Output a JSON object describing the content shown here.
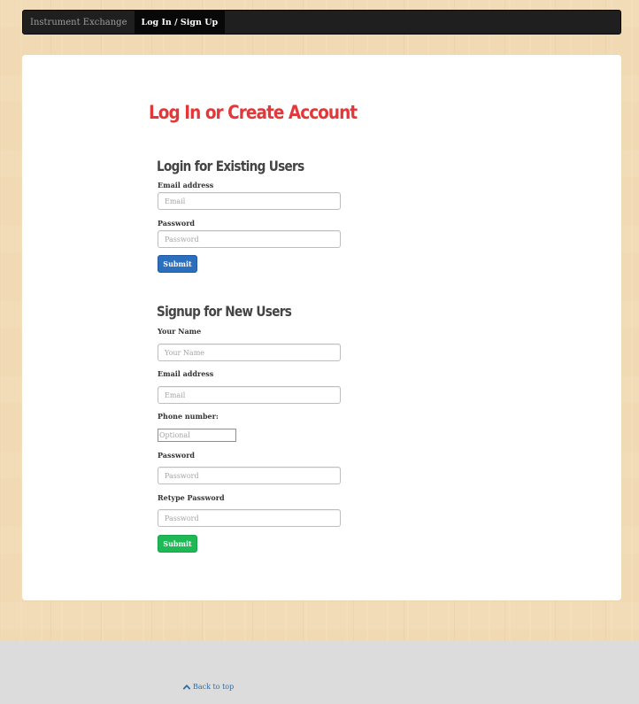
{
  "nav": {
    "brand": "Instrument Exchange",
    "items": [
      {
        "label": "Log In / Sign Up",
        "active": true
      }
    ]
  },
  "page": {
    "title": "Log In or Create Account"
  },
  "login": {
    "heading": "Login for Existing Users",
    "email_label": "Email address",
    "email_placeholder": "Email",
    "password_label": "Password",
    "password_placeholder": "Password",
    "submit_label": "Submit"
  },
  "signup": {
    "heading": "Signup for New Users",
    "name_label": "Your Name",
    "name_placeholder": "Your Name",
    "email_label": "Email address",
    "email_placeholder": "Email",
    "phone_label": "Phone number:",
    "phone_placeholder": "Optional",
    "password_label": "Password",
    "password_placeholder": "Password",
    "retype_label": "Retype Password",
    "retype_placeholder": "Password",
    "submit_label": "Submit"
  },
  "footer": {
    "back_to_top": "Back to top",
    "back_icon": "chevron-up-icon"
  },
  "colors": {
    "title_red": "#e3383a",
    "navbar_bg": "#1f1f1f",
    "primary_button": "#2b6fbf",
    "success_button": "#1db954",
    "link_blue": "#2f6da6",
    "footer_bg": "#dcdcdc"
  }
}
